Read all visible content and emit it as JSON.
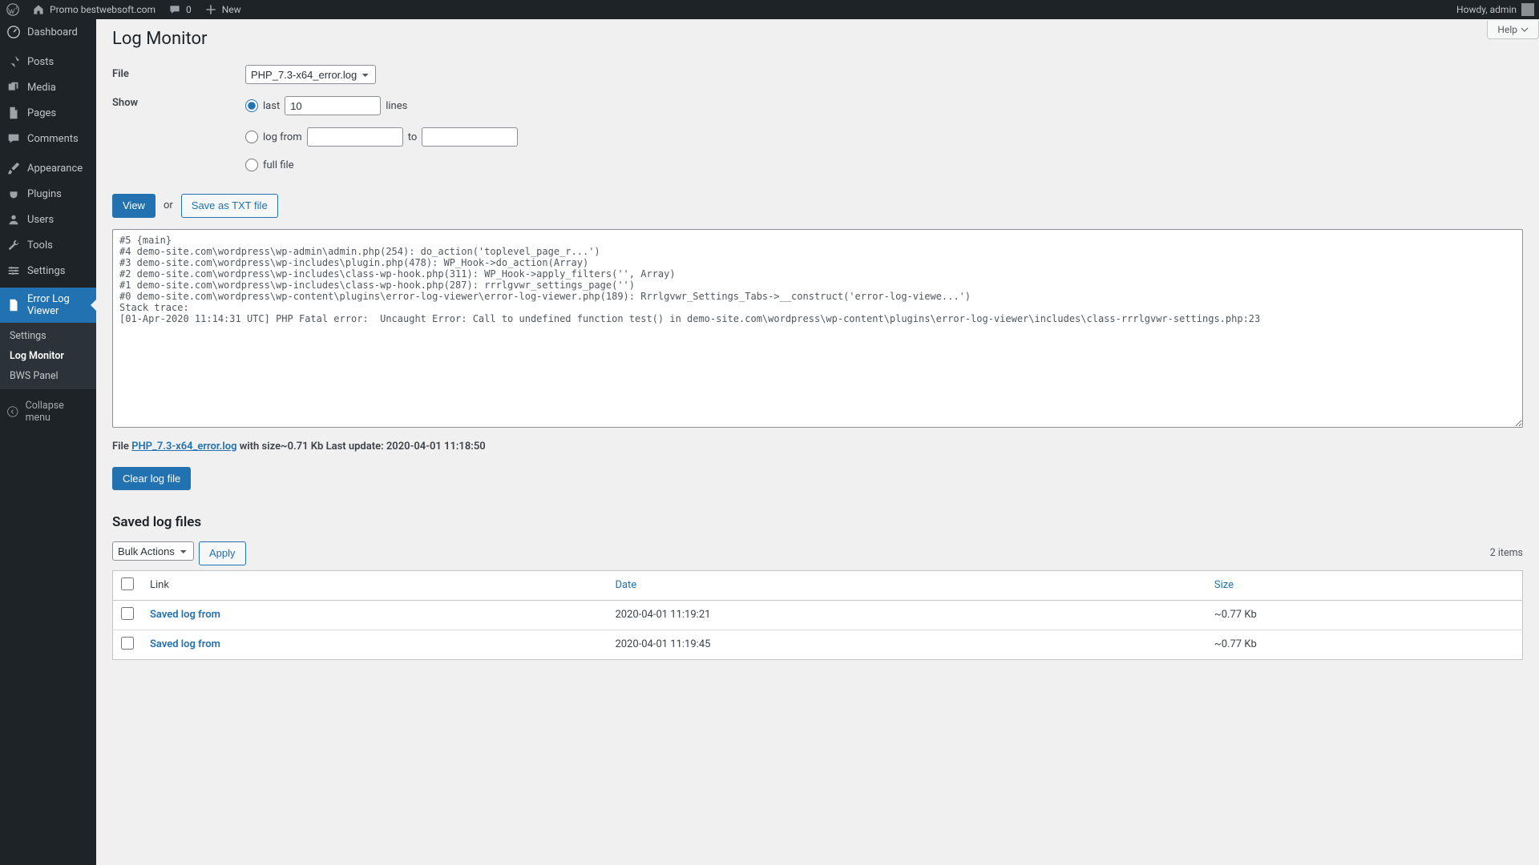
{
  "adminbar": {
    "site_name": "Promo bestwebsoft.com",
    "comment_count": "0",
    "new_label": "New",
    "howdy": "Howdy, admin"
  },
  "sidebar": {
    "items": [
      {
        "label": "Dashboard"
      },
      {
        "label": "Posts"
      },
      {
        "label": "Media"
      },
      {
        "label": "Pages"
      },
      {
        "label": "Comments"
      },
      {
        "label": "Appearance"
      },
      {
        "label": "Plugins"
      },
      {
        "label": "Users"
      },
      {
        "label": "Tools"
      },
      {
        "label": "Settings"
      },
      {
        "label": "Error Log Viewer"
      }
    ],
    "submenu": [
      {
        "label": "Settings"
      },
      {
        "label": "Log Monitor"
      },
      {
        "label": "BWS Panel"
      }
    ],
    "collapse": "Collapse menu"
  },
  "help_label": "Help",
  "page": {
    "title": "Log Monitor",
    "label_file": "File",
    "label_show": "Show",
    "file_select": "PHP_7.3-x64_error.log",
    "opt_last": "last",
    "last_value": "10",
    "opt_last_suffix": "lines",
    "opt_range": "log from",
    "opt_range_to": "to",
    "opt_full": "full file",
    "btn_view": "View",
    "or_text": "or",
    "btn_save_txt": "Save as TXT file",
    "log_content": "#5 {main}\n#4 demo-site.com\\wordpress\\wp-admin\\admin.php(254): do_action('toplevel_page_r...')\n#3 demo-site.com\\wordpress\\wp-includes\\plugin.php(478): WP_Hook->do_action(Array)\n#2 demo-site.com\\wordpress\\wp-includes\\class-wp-hook.php(311): WP_Hook->apply_filters('', Array)\n#1 demo-site.com\\wordpress\\wp-includes\\class-wp-hook.php(287): rrrlgvwr_settings_page('')\n#0 demo-site.com\\wordpress\\wp-content\\plugins\\error-log-viewer\\error-log-viewer.php(189): Rrrlgvwr_Settings_Tabs->__construct('error-log-viewe...')\nStack trace:\n[01-Apr-2020 11:14:31 UTC] PHP Fatal error:  Uncaught Error: Call to undefined function test() in demo-site.com\\wordpress\\wp-content\\plugins\\error-log-viewer\\includes\\class-rrrlgvwr-settings.php:23",
    "file_info_pre": "File ",
    "file_info_link": "PHP_7.3-x64_error.log",
    "file_info_post": " with size~0.71 Kb Last update: 2020-04-01 11:18:50",
    "btn_clear": "Clear log file",
    "saved_heading": "Saved log files",
    "bulk_label": "Bulk Actions",
    "apply_label": "Apply",
    "items_count": "2 items",
    "cols": {
      "link": "Link",
      "date": "Date",
      "size": "Size"
    },
    "rows": [
      {
        "link": "Saved log from",
        "date": "2020-04-01 11:19:21",
        "size": "~0.77 Kb"
      },
      {
        "link": "Saved log from",
        "date": "2020-04-01 11:19:45",
        "size": "~0.77 Kb"
      }
    ]
  }
}
